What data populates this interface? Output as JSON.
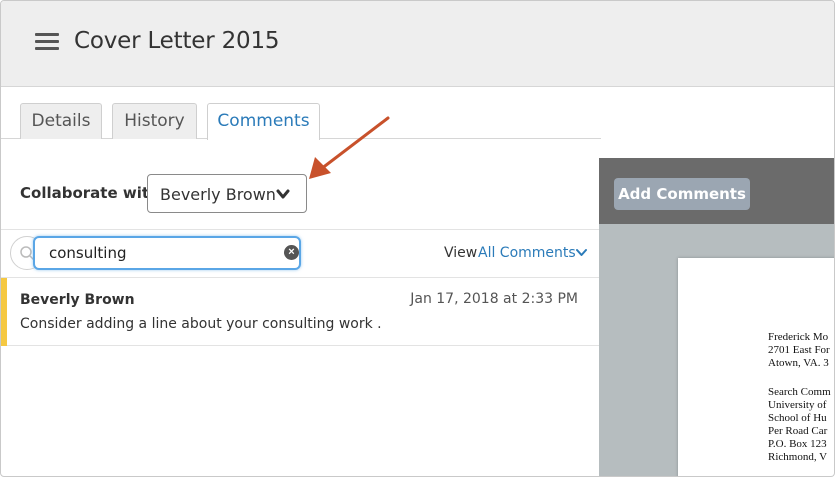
{
  "header": {
    "title": "Cover Letter 2015"
  },
  "tabs": [
    {
      "label": "Details"
    },
    {
      "label": "History"
    },
    {
      "label": "Comments"
    }
  ],
  "collaborate": {
    "label": "Collaborate with",
    "selected": "Beverly Brown"
  },
  "search": {
    "value": "consulting",
    "clear_label": "×"
  },
  "view": {
    "label": "View",
    "link": "All Comments"
  },
  "comments": [
    {
      "author": "Beverly Brown",
      "date": "Jan 17, 2018 at 2:33 PM",
      "text": "Consider adding a line about your consulting work ."
    }
  ],
  "document": {
    "add_comments_label": "Add Comments",
    "lines": [
      "Frederick Mo",
      "2701 East For",
      "Atown, VA. 3",
      "Search Comm",
      "University of",
      "School of Hu",
      "Per Road Car",
      "P.O. Box 123",
      "Richmond, V"
    ]
  },
  "colors": {
    "accent": "#2b7bb9",
    "comment_marker": "#f5c842",
    "annotation_arrow": "#c8512b"
  }
}
